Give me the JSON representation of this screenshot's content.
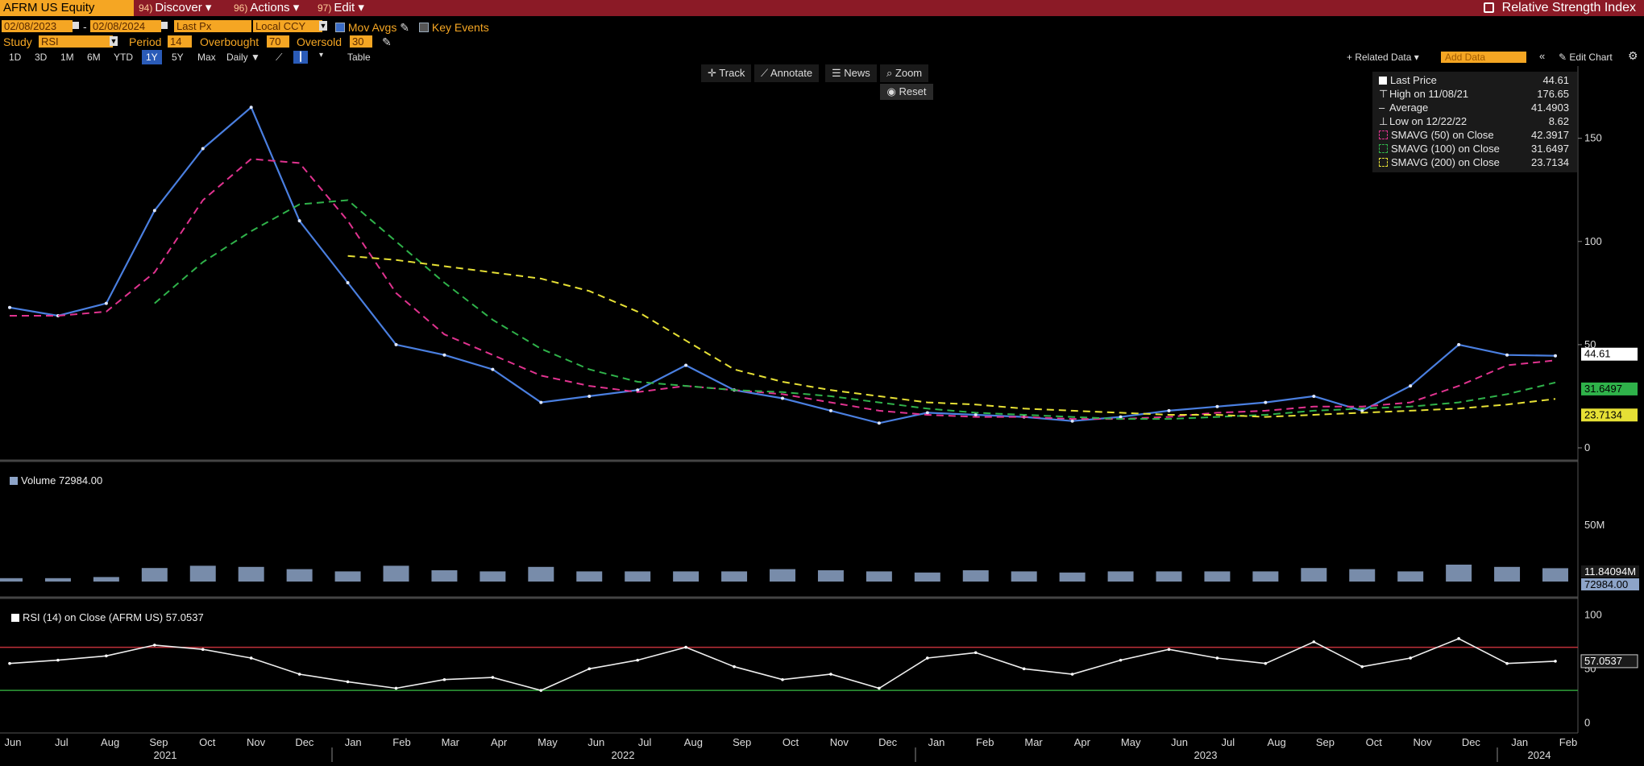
{
  "header": {
    "ticker": "AFRM US Equity",
    "menus": [
      {
        "num": "94)",
        "label": "Discover ▾"
      },
      {
        "num": "96)",
        "label": "Actions ▾"
      },
      {
        "num": "97)",
        "label": "Edit ▾"
      }
    ],
    "title": "Relative Strength Index"
  },
  "controls": {
    "start_date": "02/08/2023",
    "end_date": "02/08/2024",
    "field": "Last Px",
    "currency": "Local CCY",
    "mov_avgs": "Mov Avgs",
    "key_events": "Key Events",
    "study_label": "Study",
    "study": "RSI",
    "period_label": "Period",
    "period": "14",
    "overbought_label": "Overbought",
    "overbought": "70",
    "oversold_label": "Oversold",
    "oversold": "30",
    "periods": [
      "1D",
      "3D",
      "1M",
      "6M",
      "YTD",
      "1Y",
      "5Y",
      "Max"
    ],
    "selected_period": "1Y",
    "frequency": "Daily ▼",
    "table": "Table",
    "related_data": "+ Related Data ▾",
    "add_data": "Add Data",
    "edit_chart": "Edit Chart",
    "tools": [
      "Track",
      "Annotate",
      "News",
      "Zoom"
    ],
    "reset": "Reset"
  },
  "legend": [
    {
      "label": "Last Price",
      "value": "44.61"
    },
    {
      "label": "High on 11/08/21",
      "value": "176.65"
    },
    {
      "label": "Average",
      "value": "41.4903"
    },
    {
      "label": "Low on 12/22/22",
      "value": "8.62"
    },
    {
      "label": "SMAVG (50)  on Close",
      "value": "42.3917"
    },
    {
      "label": "SMAVG (100)  on Close",
      "value": "31.6497"
    },
    {
      "label": "SMAVG (200)  on Close",
      "value": "23.7134"
    }
  ],
  "colors": {
    "price": "#4a7fe0",
    "sma50": "#e0338f",
    "sma100": "#2fb24a",
    "sma200": "#e6e035",
    "rsi_upper": "#c0303a",
    "rsi_lower": "#2fa03a",
    "volume": "#8da4c8"
  },
  "volume_panel": {
    "label": "Volume 72984.00",
    "axis_labels": [
      "50M"
    ],
    "last_labels": [
      "11.84094M",
      "72984.00"
    ]
  },
  "rsi_panel": {
    "label": "RSI (14)  on Close (AFRM US) 57.0537",
    "axis_labels": [
      "100",
      "50",
      "0"
    ],
    "last_label": "57.0537"
  },
  "price_axis": {
    "labels": [
      "150",
      "100",
      "50",
      "0"
    ],
    "last_labels": [
      "44.61",
      "31.6497",
      "23.7134"
    ]
  },
  "x_axis": {
    "months": [
      "Jun",
      "Jul",
      "Aug",
      "Sep",
      "Oct",
      "Nov",
      "Dec",
      "Jan",
      "Feb",
      "Mar",
      "Apr",
      "May",
      "Jun",
      "Jul",
      "Aug",
      "Sep",
      "Oct",
      "Nov",
      "Dec",
      "Jan",
      "Feb",
      "Mar",
      "Apr",
      "May",
      "Jun",
      "Jul",
      "Aug",
      "Sep",
      "Oct",
      "Nov",
      "Dec",
      "Jan",
      "Feb"
    ],
    "years": [
      "2021",
      "2022",
      "2023",
      "2024"
    ]
  },
  "chart_data": {
    "type": "line",
    "series": [
      {
        "name": "Last Price",
        "x": [
          "2021-06",
          "2021-07",
          "2021-08",
          "2021-09",
          "2021-10",
          "2021-11",
          "2021-12",
          "2022-01",
          "2022-02",
          "2022-03",
          "2022-04",
          "2022-05",
          "2022-06",
          "2022-07",
          "2022-08",
          "2022-09",
          "2022-10",
          "2022-11",
          "2022-12",
          "2023-01",
          "2023-02",
          "2023-03",
          "2023-04",
          "2023-05",
          "2023-06",
          "2023-07",
          "2023-08",
          "2023-09",
          "2023-10",
          "2023-11",
          "2023-12",
          "2024-01",
          "2024-02"
        ],
        "values": [
          68,
          64,
          70,
          115,
          145,
          165,
          110,
          80,
          50,
          45,
          38,
          22,
          25,
          28,
          40,
          28,
          24,
          18,
          12,
          17,
          16,
          15,
          13,
          15,
          18,
          20,
          22,
          25,
          18,
          30,
          50,
          45,
          44.61
        ]
      },
      {
        "name": "SMAVG (50)  on Close",
        "values": [
          64,
          64,
          66,
          85,
          120,
          140,
          138,
          110,
          75,
          55,
          45,
          35,
          30,
          27,
          30,
          28,
          26,
          22,
          18,
          16,
          15,
          15,
          14,
          14,
          15,
          17,
          18,
          20,
          20,
          22,
          30,
          40,
          42.39
        ]
      },
      {
        "name": "SMAVG (100)  on Close",
        "values": [
          null,
          null,
          null,
          70,
          90,
          105,
          118,
          120,
          100,
          80,
          62,
          48,
          38,
          32,
          30,
          28,
          27,
          25,
          22,
          19,
          17,
          16,
          15,
          14,
          14,
          15,
          16,
          18,
          19,
          20,
          22,
          26,
          31.65
        ]
      },
      {
        "name": "SMAVG (200)  on Close",
        "values": [
          null,
          null,
          null,
          null,
          null,
          null,
          null,
          93,
          91,
          88,
          85,
          82,
          76,
          66,
          52,
          38,
          32,
          28,
          25,
          22,
          21,
          19,
          18,
          17,
          16,
          16,
          15,
          16,
          17,
          18,
          19,
          21,
          23.71
        ]
      }
    ],
    "volume": {
      "values": [
        3,
        3,
        4,
        12,
        14,
        13,
        11,
        9,
        14,
        10,
        9,
        13,
        9,
        9,
        9,
        9,
        11,
        10,
        9,
        8,
        10,
        9,
        8,
        9,
        9,
        9,
        9,
        12,
        11,
        9,
        15,
        13,
        11.84
      ]
    },
    "rsi": {
      "values": [
        55,
        58,
        62,
        72,
        68,
        60,
        45,
        38,
        32,
        40,
        42,
        30,
        50,
        58,
        70,
        52,
        40,
        45,
        32,
        60,
        65,
        50,
        45,
        58,
        68,
        60,
        55,
        75,
        52,
        60,
        78,
        55,
        57.05
      ],
      "overbought": 70,
      "oversold": 30
    },
    "ylim_price": [
      0,
      185
    ],
    "ylim_volume": [
      0,
      90
    ],
    "ylim_rsi": [
      -5,
      110
    ]
  }
}
